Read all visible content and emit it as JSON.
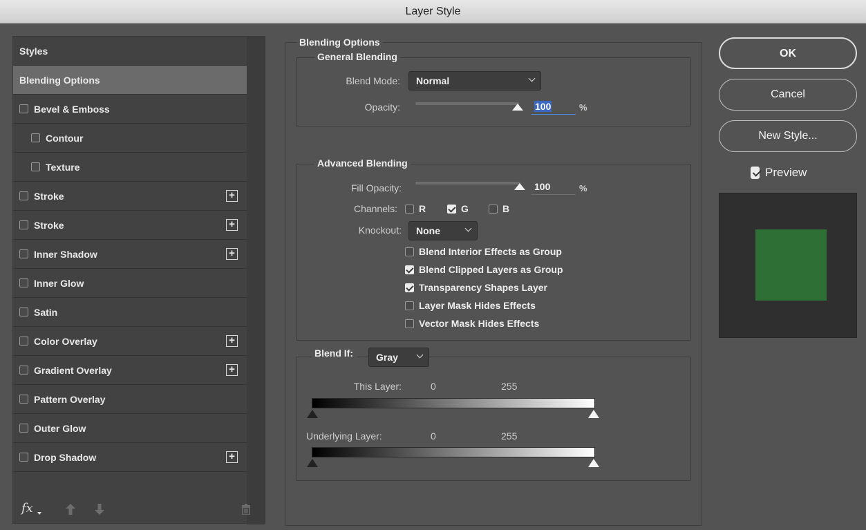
{
  "window": {
    "title": "Layer Style"
  },
  "styles_panel": {
    "items": [
      {
        "label": "Styles",
        "checkbox": false,
        "indent": false,
        "selected": false,
        "plus": false
      },
      {
        "label": "Blending Options",
        "checkbox": false,
        "indent": false,
        "selected": true,
        "plus": false
      },
      {
        "label": "Bevel & Emboss",
        "checkbox": true,
        "checked": false,
        "indent": false,
        "plus": false
      },
      {
        "label": "Contour",
        "checkbox": true,
        "checked": false,
        "indent": true,
        "plus": false
      },
      {
        "label": "Texture",
        "checkbox": true,
        "checked": false,
        "indent": true,
        "plus": false
      },
      {
        "label": "Stroke",
        "checkbox": true,
        "checked": false,
        "indent": false,
        "plus": true
      },
      {
        "label": "Stroke",
        "checkbox": true,
        "checked": false,
        "indent": false,
        "plus": true
      },
      {
        "label": "Inner Shadow",
        "checkbox": true,
        "checked": false,
        "indent": false,
        "plus": true
      },
      {
        "label": "Inner Glow",
        "checkbox": true,
        "checked": false,
        "indent": false,
        "plus": false
      },
      {
        "label": "Satin",
        "checkbox": true,
        "checked": false,
        "indent": false,
        "plus": false
      },
      {
        "label": "Color Overlay",
        "checkbox": true,
        "checked": false,
        "indent": false,
        "plus": true
      },
      {
        "label": "Gradient Overlay",
        "checkbox": true,
        "checked": false,
        "indent": false,
        "plus": true
      },
      {
        "label": "Pattern Overlay",
        "checkbox": true,
        "checked": false,
        "indent": false,
        "plus": false
      },
      {
        "label": "Outer Glow",
        "checkbox": true,
        "checked": false,
        "indent": false,
        "plus": false
      },
      {
        "label": "Drop Shadow",
        "checkbox": true,
        "checked": false,
        "indent": false,
        "plus": true
      }
    ],
    "footer": {
      "fx_label": "fx",
      "icons": [
        "fx-menu-icon",
        "move-up-icon",
        "move-down-icon",
        "trash-icon"
      ]
    }
  },
  "blending": {
    "section_title": "Blending Options",
    "general": {
      "title": "General Blending",
      "blend_mode_label": "Blend Mode:",
      "blend_mode_value": "Normal",
      "opacity_label": "Opacity:",
      "opacity_value": "100",
      "opacity_unit": "%"
    },
    "advanced": {
      "title": "Advanced Blending",
      "fill_opacity_label": "Fill Opacity:",
      "fill_opacity_value": "100",
      "fill_opacity_unit": "%",
      "channels_label": "Channels:",
      "channels": [
        {
          "label": "R",
          "checked": false
        },
        {
          "label": "G",
          "checked": true
        },
        {
          "label": "B",
          "checked": false
        }
      ],
      "knockout_label": "Knockout:",
      "knockout_value": "None",
      "options": [
        {
          "label": "Blend Interior Effects as Group",
          "checked": false
        },
        {
          "label": "Blend Clipped Layers as Group",
          "checked": true
        },
        {
          "label": "Transparency Shapes Layer",
          "checked": true
        },
        {
          "label": "Layer Mask Hides Effects",
          "checked": false
        },
        {
          "label": "Vector Mask Hides Effects",
          "checked": false
        }
      ]
    },
    "blend_if": {
      "label": "Blend If:",
      "value": "Gray",
      "this_layer_label": "This Layer:",
      "this_layer_min": "0",
      "this_layer_max": "255",
      "underlying_label": "Underlying Layer:",
      "underlying_min": "0",
      "underlying_max": "255"
    }
  },
  "actions": {
    "ok": "OK",
    "cancel": "Cancel",
    "new_style": "New Style...",
    "preview_label": "Preview",
    "preview_checked": true,
    "preview_color": "#2e6f36"
  }
}
